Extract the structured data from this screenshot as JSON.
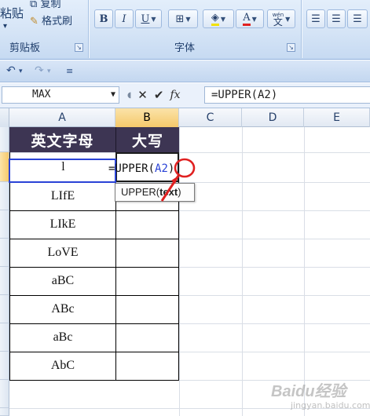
{
  "ribbon": {
    "paste_label": "粘贴",
    "copy_label": "复制",
    "format_painter_label": "格式刷",
    "clipboard_group": "剪贴板",
    "font_group": "字体",
    "bold": "B",
    "italic": "I",
    "underline": "U",
    "phonetic": "文",
    "phonetic_small": "wén"
  },
  "namebox": {
    "value": "MAX"
  },
  "formula_bar": {
    "cancel": "✕",
    "enter": "✔",
    "fx": "fx",
    "value": "=UPPER(A2)"
  },
  "columns": [
    "A",
    "B",
    "C",
    "D",
    "E"
  ],
  "table": {
    "header_a": "英文字母",
    "header_b": "大写",
    "rows": [
      "l",
      "LIfE",
      "LIkE",
      "LoVE",
      "aBC",
      "ABc",
      "aBc",
      "AbC"
    ]
  },
  "edit": {
    "prefix": "=UPPER(",
    "ref": "A2",
    "suffix": ")"
  },
  "tooltip": {
    "func": "UPPER(",
    "arg": "text",
    "close": ")"
  },
  "colors": {
    "header_fill": "#3d3553",
    "ref_blue": "#2a43d6",
    "active_header": "#f5c96b",
    "annotation": "#e02020"
  },
  "watermark": {
    "main": "Baidu经验",
    "sub": "jingyan.baidu.com"
  }
}
